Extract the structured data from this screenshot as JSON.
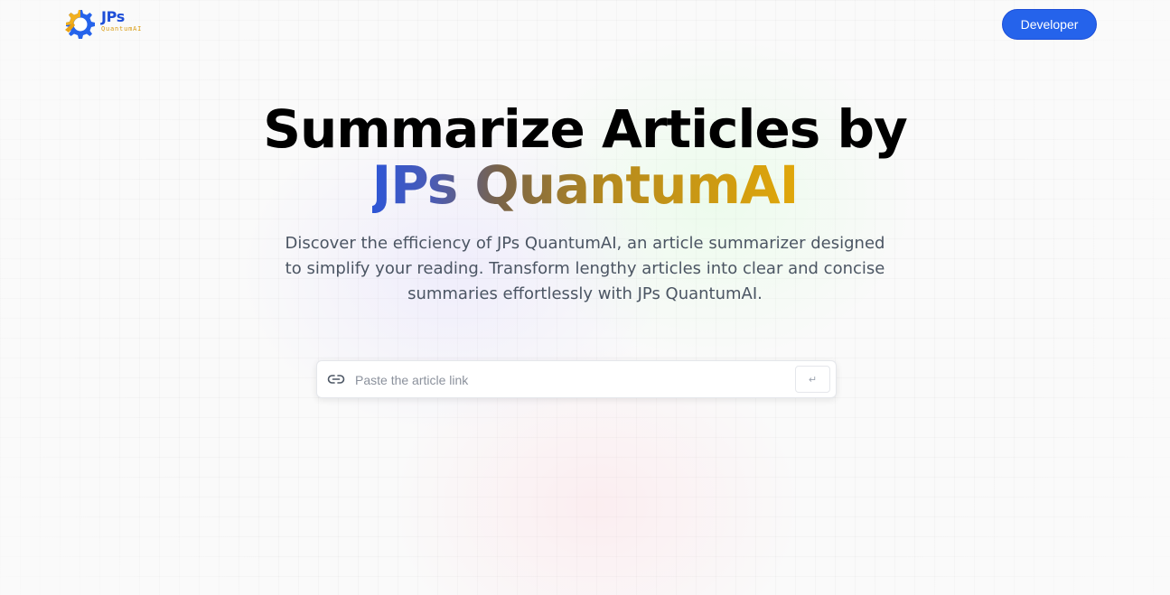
{
  "header": {
    "logo": {
      "title": "JPs",
      "subtitle": "QuantumAI",
      "icon": "gear-icon"
    },
    "developer_button_label": "Developer"
  },
  "hero": {
    "title_line1": "Summarize Articles by",
    "title_line2": "JPs QuantumAI",
    "description": "Discover the efficiency of JPs QuantumAI, an article summarizer designed to simplify your reading. Transform lengthy articles into clear and concise summaries effortlessly with JPs QuantumAI."
  },
  "search": {
    "placeholder": "Paste the article link",
    "value": "",
    "icon": "link-icon",
    "submit_glyph": "↵"
  },
  "colors": {
    "accent": "#2563eb",
    "brand_gradient_start": "#2d55d6",
    "brand_gradient_end": "#e0a70a",
    "logo_blue": "#1d4ed8",
    "logo_gold": "#d99a0d"
  }
}
